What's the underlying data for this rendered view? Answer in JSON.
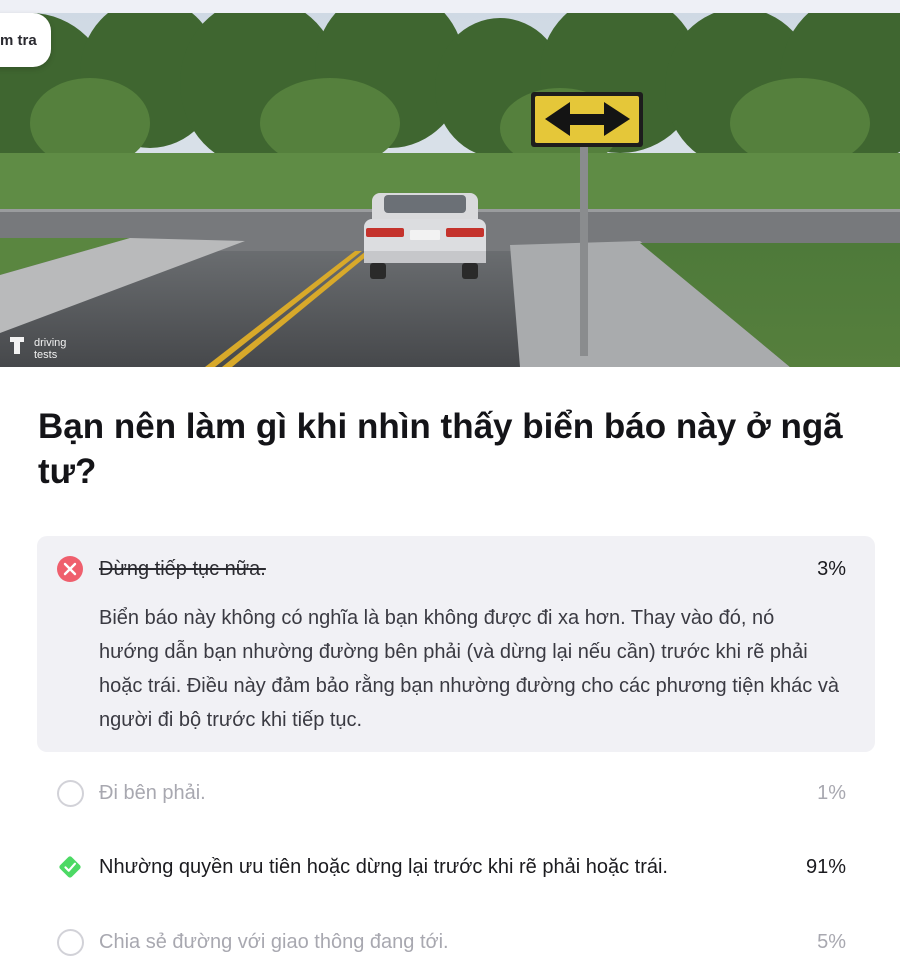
{
  "header": {
    "tag_label": "m tra"
  },
  "hero": {
    "watermark_line1": "driving",
    "watermark_line2": "tests",
    "sign_icon": "double-arrow-icon"
  },
  "question": {
    "text": "Bạn nên làm gì khi nhìn thấy biển báo này ở ngã tư?"
  },
  "answers": [
    {
      "label": "Dừng tiếp tục nữa.",
      "percent": "3%",
      "state": "wrong-selected",
      "icon": "x-circle-icon",
      "explanation": "Biển báo này không có nghĩa là bạn không được đi xa hơn. Thay vào đó, nó hướng dẫn bạn nhường đường bên phải (và dừng lại nếu cần) trước khi rẽ phải hoặc trái. Điều này đảm bảo rằng bạn nhường đường cho các phương tiện khác và người đi bộ trước khi tiếp tục."
    },
    {
      "label": "Đi bên phải.",
      "percent": "1%",
      "state": "unselected",
      "icon": "radio-icon"
    },
    {
      "label": "Nhường quyền ưu tiên hoặc dừng lại trước khi rẽ phải hoặc trái.",
      "percent": "91%",
      "state": "correct",
      "icon": "check-diamond-icon"
    },
    {
      "label": "Chia sẻ đường với giao thông đang tới.",
      "percent": "5%",
      "state": "unselected",
      "icon": "radio-icon"
    }
  ],
  "colors": {
    "wrong": "#ef5f6d",
    "correct": "#4cd964",
    "card_bg": "#f1f1f5",
    "sign_yellow": "#e5c739"
  }
}
